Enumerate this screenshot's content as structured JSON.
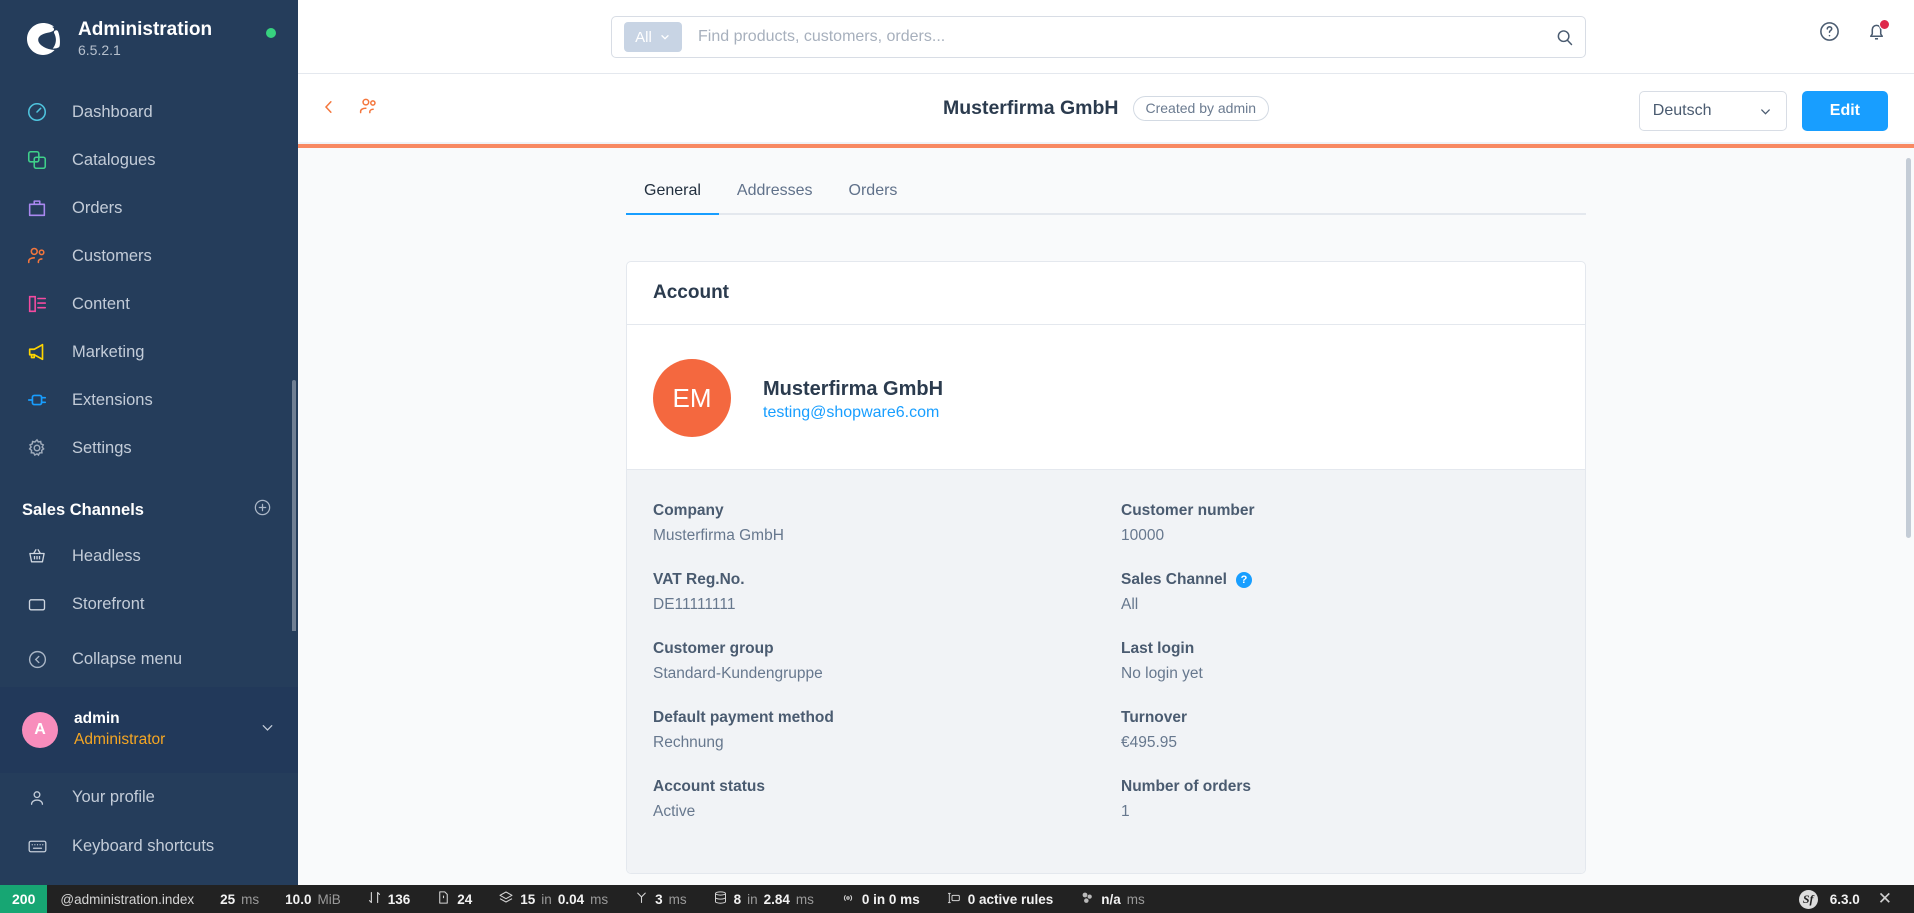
{
  "sidebar": {
    "brand": {
      "title": "Administration",
      "version": "6.5.2.1",
      "status_dot_color": "#37d27f"
    },
    "nav_items": [
      {
        "label": "Dashboard",
        "icon": "gauge-icon",
        "color": "#4fc3dd"
      },
      {
        "label": "Catalogues",
        "icon": "copy-icon",
        "color": "#3fd08a"
      },
      {
        "label": "Orders",
        "icon": "bag-icon",
        "color": "#a988ef"
      },
      {
        "label": "Customers",
        "icon": "users-icon",
        "color": "#f4763c"
      },
      {
        "label": "Content",
        "icon": "layout-icon",
        "color": "#f44ba0"
      },
      {
        "label": "Marketing",
        "icon": "megaphone-icon",
        "color": "#ffd500"
      },
      {
        "label": "Extensions",
        "icon": "plug-icon",
        "color": "#189eff"
      },
      {
        "label": "Settings",
        "icon": "gear-icon",
        "color": "#9fabbb"
      }
    ],
    "sales_channels": {
      "title": "Sales Channels",
      "add_label": "+",
      "items": [
        {
          "label": "Headless",
          "icon": "basket-icon"
        },
        {
          "label": "Storefront",
          "icon": "storefront-icon"
        }
      ]
    },
    "collapse_label": "Collapse menu",
    "profile": {
      "initial": "A",
      "name": "admin",
      "role": "Administrator"
    },
    "footer_items": [
      {
        "label": "Your profile",
        "icon": "user-icon"
      },
      {
        "label": "Keyboard shortcuts",
        "icon": "keyboard-icon"
      }
    ]
  },
  "topbar": {
    "scope_label": "All",
    "search_placeholder": "Find products, customers, orders...",
    "search_value": "",
    "help_icon": "question-circle-icon",
    "notifications_icon": "bell-icon",
    "notification_badge_color": "#de294c"
  },
  "page_header": {
    "back_icon": "chevron-left-icon",
    "entity_icon": "customers-icon",
    "title": "Musterfirma GmbH",
    "badge": "Created by admin",
    "language": "Deutsch",
    "edit_label": "Edit",
    "accent_color": "#f88962"
  },
  "tabs": [
    {
      "label": "General",
      "active": true
    },
    {
      "label": "Addresses",
      "active": false
    },
    {
      "label": "Orders",
      "active": false
    }
  ],
  "account_card": {
    "heading": "Account",
    "avatar_initials": "EM",
    "avatar_color": "#f4683f",
    "name": "Musterfirma GmbH",
    "email": "testing@shopware6.com"
  },
  "details": {
    "left": [
      {
        "label": "Company",
        "value": "Musterfirma GmbH"
      },
      {
        "label": "VAT Reg.No.",
        "value": "DE11111111"
      },
      {
        "label": "Customer group",
        "value": "Standard-Kundengruppe"
      },
      {
        "label": "Default payment method",
        "value": "Rechnung"
      },
      {
        "label": "Account status",
        "value": "Active"
      }
    ],
    "right": [
      {
        "label": "Customer number",
        "value": "10000",
        "help": false
      },
      {
        "label": "Sales Channel",
        "value": "All",
        "help": true
      },
      {
        "label": "Last login",
        "value": "No login yet",
        "help": false
      },
      {
        "label": "Turnover",
        "value": "€495.95",
        "help": false
      },
      {
        "label": "Number of orders",
        "value": "1",
        "help": false
      }
    ]
  },
  "debug_bar": {
    "status_code": "200",
    "route": "@administration.index",
    "time": "25",
    "time_unit": "ms",
    "memory": "10.0",
    "memory_unit": "MiB",
    "transfer_icon": "arrows-updown-icon",
    "transfer": "136",
    "files_icon": "file-icon",
    "files": "24",
    "layers_icon": "layers-icon",
    "layers_count": "15",
    "layers_in": "in",
    "layers_time": "0.04",
    "layers_unit": "ms",
    "twig_icon": "twig-icon",
    "twig_time": "3",
    "twig_unit": "ms",
    "db_icon": "database-icon",
    "db_count": "8",
    "db_in": "in",
    "db_time": "2.84",
    "db_unit": "ms",
    "cache_icon": "broadcast-icon",
    "cache_text": "0 in 0 ms",
    "rules_icon": "rules-icon",
    "rules_text": "0 active rules",
    "cluster_icon": "cluster-icon",
    "cluster_value": "n/a",
    "cluster_unit": "ms",
    "symfony_label": "6.3.0",
    "close_icon": "close-icon"
  }
}
